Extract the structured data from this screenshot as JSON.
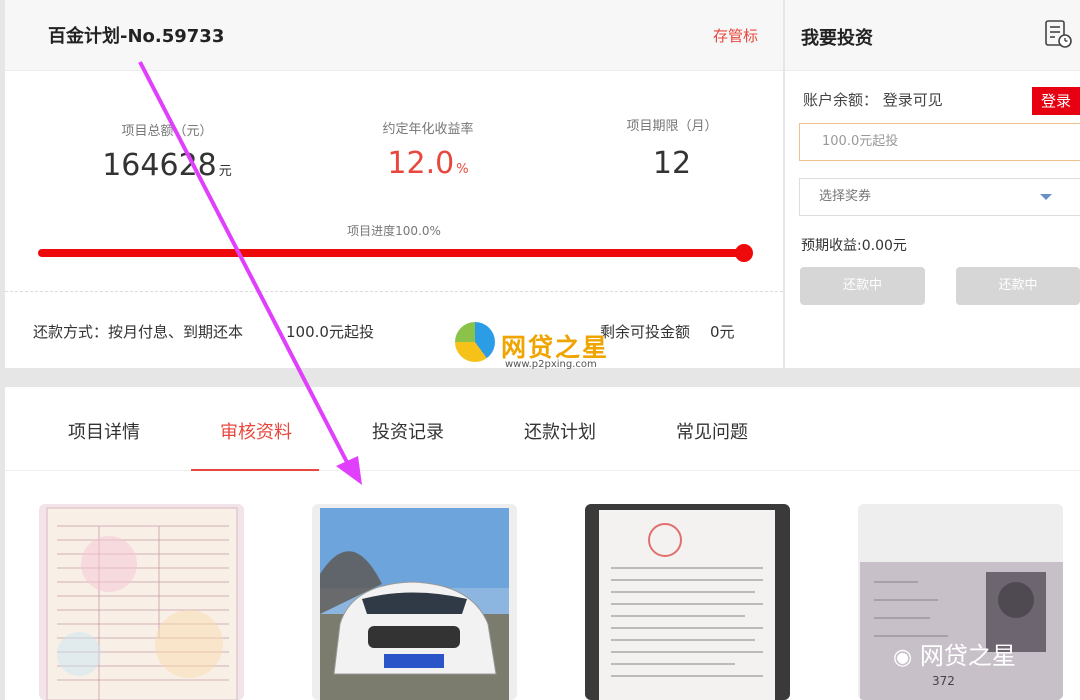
{
  "project": {
    "title": "百金计划-No.59733",
    "badge": "存管标",
    "stats": [
      {
        "label": "项目总额（元）",
        "value": "164628",
        "unit": "元"
      },
      {
        "label": "约定年化收益率",
        "value": "12.0",
        "unit": "%"
      },
      {
        "label": "项目期限（月）",
        "value": "12",
        "unit": ""
      }
    ],
    "progress_label": "项目进度100.0%",
    "progress_fraction": 1.0,
    "repayment_method": "还款方式：按月付息、到期还本",
    "min_invest": "100.0元起投",
    "remaining_label": "剩余可投金额",
    "remaining_value": "0元"
  },
  "invest": {
    "title": "我要投资",
    "balance_label": "账户余额：",
    "balance_value": "登录可见",
    "login_label": "登录",
    "amount_placeholder": "100.0元起投",
    "coupon_placeholder": "选择奖券",
    "expected_income": "预期收益:0.00元",
    "buttons": [
      "还款中",
      "还款中"
    ]
  },
  "tabs": [
    {
      "label": "项目详情",
      "active": false
    },
    {
      "label": "审核资料",
      "active": true
    },
    {
      "label": "投资记录",
      "active": false
    },
    {
      "label": "还款计划",
      "active": false
    },
    {
      "label": "常见问题",
      "active": false
    }
  ],
  "documents": [
    {
      "kind": "vehicle-registration-certificate"
    },
    {
      "kind": "car-photo"
    },
    {
      "kind": "agreement-document"
    },
    {
      "kind": "id-card",
      "visible_number": "372"
    }
  ],
  "watermark": {
    "name": "网贷之星",
    "url": "www.p2pxing.com",
    "wechat": "网贷之星"
  },
  "colors": {
    "accent_red": "#e8473d",
    "progress_red": "#ee0a0a",
    "login_red": "#e60012",
    "annotation_magenta": "#e040fb"
  }
}
